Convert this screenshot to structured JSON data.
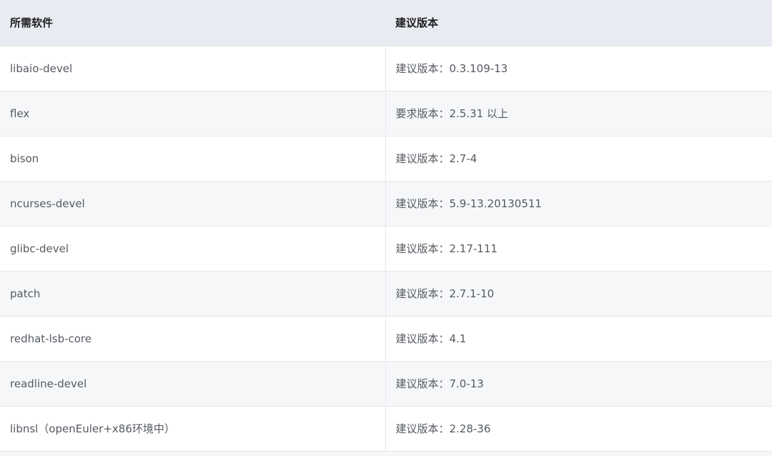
{
  "table": {
    "headers": [
      "所需软件",
      "建议版本"
    ],
    "rows": [
      [
        "libaio-devel",
        "建议版本：0.3.109-13"
      ],
      [
        "flex",
        "要求版本：2.5.31 以上"
      ],
      [
        "bison",
        "建议版本：2.7-4"
      ],
      [
        "ncurses-devel",
        "建议版本：5.9-13.20130511"
      ],
      [
        "glibc-devel",
        "建议版本：2.17-111"
      ],
      [
        "patch",
        "建议版本：2.7.1-10"
      ],
      [
        "redhat-lsb-core",
        "建议版本：4.1"
      ],
      [
        "readline-devel",
        "建议版本：7.0-13"
      ],
      [
        "libnsl（openEuler+x86环境中）",
        "建议版本：2.28-36"
      ]
    ]
  }
}
